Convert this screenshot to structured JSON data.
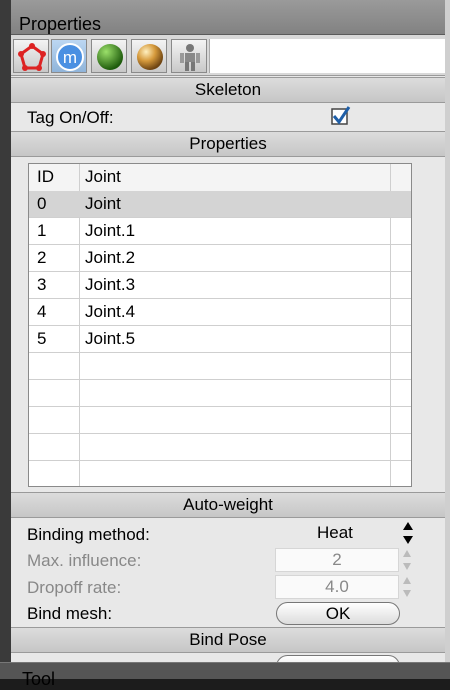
{
  "panel": {
    "title": "Properties",
    "tabs": [
      {
        "icon": "polygon-object-icon"
      },
      {
        "icon": "material-m-icon",
        "selected": true
      },
      {
        "icon": "green-sphere-icon"
      },
      {
        "icon": "gold-sphere-icon"
      },
      {
        "icon": "figure-skeleton-icon"
      }
    ]
  },
  "skeleton": {
    "header": "Skeleton",
    "tag_label": "Tag On/Off:",
    "tag_checked": true
  },
  "properties": {
    "header": "Properties",
    "columns": [
      "ID",
      "Joint"
    ],
    "rows": [
      {
        "id": "0",
        "name": "Joint",
        "selected": true
      },
      {
        "id": "1",
        "name": "Joint.1"
      },
      {
        "id": "2",
        "name": "Joint.2"
      },
      {
        "id": "3",
        "name": "Joint.3"
      },
      {
        "id": "4",
        "name": "Joint.4"
      },
      {
        "id": "5",
        "name": "Joint.5"
      }
    ]
  },
  "autoweight": {
    "header": "Auto-weight",
    "binding_method_label": "Binding method:",
    "binding_method_value": "Heat",
    "max_influence_label": "Max. influence:",
    "max_influence_value": "2",
    "dropoff_label": "Dropoff rate:",
    "dropoff_value": "4.0",
    "bind_mesh_label": "Bind mesh:",
    "bind_mesh_button": "OK"
  },
  "bindpose": {
    "header": "Bind Pose"
  },
  "bottom_panel": {
    "title": "Tool"
  },
  "colors": {
    "titlebar": "#8e8e8e",
    "panel_bg": "#e8e8e8",
    "selected_row": "#d4d4d4",
    "check_blue": "#1f5fa8"
  }
}
